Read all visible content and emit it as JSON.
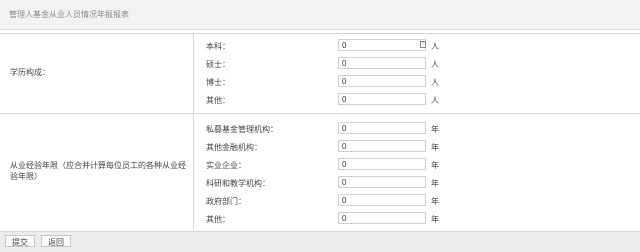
{
  "header": {
    "title": "管理人基金从业人员情况年报报表"
  },
  "education": {
    "label": "学历构成：",
    "unit": "人",
    "fields": [
      {
        "label": "本科：",
        "value": "0"
      },
      {
        "label": "硕士：",
        "value": "0"
      },
      {
        "label": "博士：",
        "value": "0"
      },
      {
        "label": "其他：",
        "value": "0"
      }
    ]
  },
  "experience": {
    "label": "从业经验年限（应合并计算每位员工的各种从业经验年限）",
    "unit": "年",
    "fields": [
      {
        "label": "私募基金管理机构：",
        "value": "0"
      },
      {
        "label": "其他金融机构：",
        "value": "0"
      },
      {
        "label": "实业企业：",
        "value": "0"
      },
      {
        "label": "科研和教学机构：",
        "value": "0"
      },
      {
        "label": "政府部门：",
        "value": "0"
      },
      {
        "label": "其他：",
        "value": "0"
      }
    ]
  },
  "actions": {
    "submit_label": "提交",
    "back_label": "返回"
  }
}
